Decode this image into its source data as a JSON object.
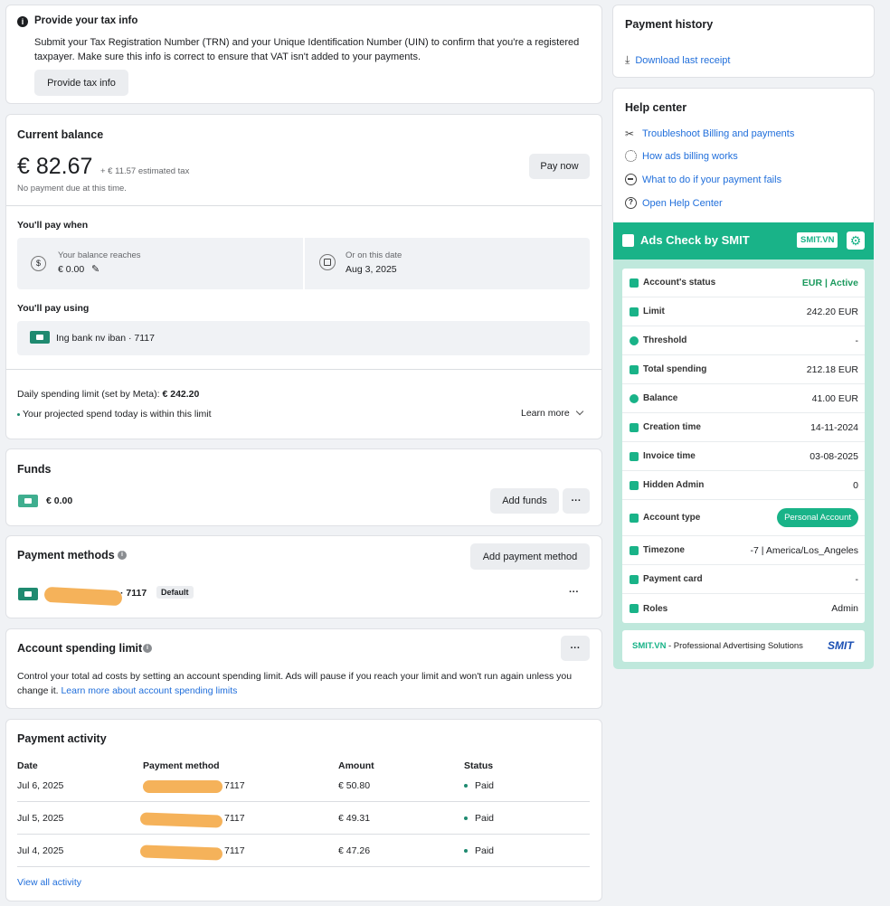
{
  "tax": {
    "title": "Provide your tax info",
    "desc": "Submit your Tax Registration Number (TRN) and your Unique Identification Number (UIN) to confirm that you're a registered taxpayer. Make sure this info is correct to ensure that VAT isn't added to your payments.",
    "button": "Provide tax info"
  },
  "balance": {
    "title": "Current balance",
    "amount": "€ 82.67",
    "tax_note": "+ € 11.57 estimated tax",
    "due_note": "No payment due at this time.",
    "pay_button": "Pay now",
    "pay_when_title": "You'll pay when",
    "threshold_label": "Your balance reaches",
    "threshold_value": "€ 0.00",
    "date_label": "Or on this date",
    "date_value": "Aug 3, 2025",
    "pay_using_title": "You'll pay using",
    "pay_using_value": "Ing bank nv iban · 7117",
    "daily_limit_label": "Daily spending limit (set by Meta): ",
    "daily_limit_value": "€ 242.20",
    "within_limit": "Your projected spend today is within this limit",
    "learn_more": "Learn more"
  },
  "funds": {
    "title": "Funds",
    "value": "€ 0.00",
    "add_button": "Add funds",
    "more": "···"
  },
  "payment_methods": {
    "title": "Payment methods",
    "add_button": "Add payment method",
    "suffix": "· 7117",
    "badge": "Default",
    "more": "···"
  },
  "spending_limit": {
    "title": "Account spending limit",
    "desc": "Control your total ad costs by setting an account spending limit. Ads will pause if you reach your limit and won't run again unless you change it. ",
    "link": "Learn more about account spending limits",
    "more": "···"
  },
  "activity": {
    "title": "Payment activity",
    "headers": [
      "Date",
      "Payment method",
      "Amount",
      "Status"
    ],
    "rows": [
      {
        "date": "Jul 6, 2025",
        "method": "7117",
        "amount": "€ 50.80",
        "status": "Paid"
      },
      {
        "date": "Jul 5, 2025",
        "method": "7117",
        "amount": "€ 49.31",
        "status": "Paid"
      },
      {
        "date": "Jul 4, 2025",
        "method": "7117",
        "amount": "€ 47.26",
        "status": "Paid"
      }
    ],
    "view_all": "View all activity"
  },
  "payment_history": {
    "title": "Payment history",
    "download": "Download last receipt"
  },
  "help": {
    "title": "Help center",
    "links": [
      "Troubleshoot Billing and payments",
      "How ads billing works",
      "What to do if your payment fails",
      "Open Help Center"
    ]
  },
  "smit": {
    "title": "Ads Check by SMIT",
    "badge": "SMIT.VN",
    "rows": [
      {
        "label": "Account's status",
        "value": "EUR | Active"
      },
      {
        "label": "Limit",
        "value": "242.20 EUR"
      },
      {
        "label": "Threshold",
        "value": "-"
      },
      {
        "label": "Total spending",
        "value": "212.18 EUR"
      },
      {
        "label": "Balance",
        "value": "41.00 EUR"
      },
      {
        "label": "Creation time",
        "value": "14-11-2024"
      },
      {
        "label": "Invoice time",
        "value": "03-08-2025"
      },
      {
        "label": "Hidden Admin",
        "value": "0"
      },
      {
        "label": "Account type",
        "value": "Personal Account"
      },
      {
        "label": "Timezone",
        "value": "-7 | America/Los_Angeles"
      },
      {
        "label": "Payment card",
        "value": "-"
      },
      {
        "label": "Roles",
        "value": "Admin"
      }
    ],
    "footer_brand": "SMIT.VN",
    "footer_text": " - Professional Advertising Solutions",
    "footer_logo": "SMIT",
    "colors": {
      "accent": "#19b388",
      "active": "#1c9a5e"
    }
  }
}
